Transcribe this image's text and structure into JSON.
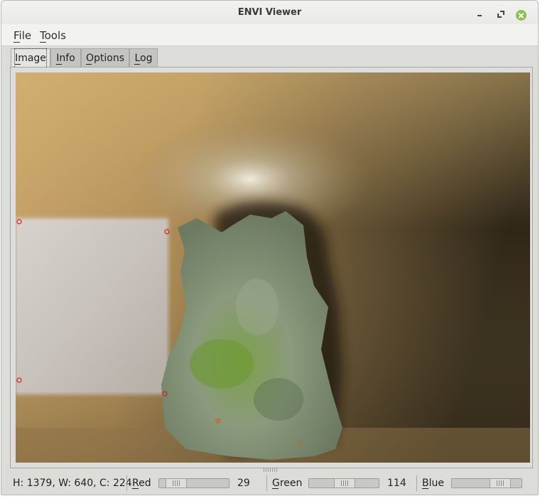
{
  "window": {
    "title": "ENVI Viewer",
    "controls": [
      "minimize-icon",
      "restore-icon",
      "close-icon"
    ],
    "close_color": "#8cc152"
  },
  "menubar": {
    "items": [
      {
        "label": "File"
      },
      {
        "label": "Tools"
      }
    ]
  },
  "tabs": [
    {
      "label": "Image",
      "active": true
    },
    {
      "label": "Info",
      "active": false
    },
    {
      "label": "Options",
      "active": false
    },
    {
      "label": "Log",
      "active": false
    }
  ],
  "image_view": {
    "content": "rgb-composite-image",
    "marker_color": "#d02020"
  },
  "statusbar": {
    "dimensions": "H: 1379, W: 640, C: 224",
    "bands": [
      {
        "label": "Red",
        "value": "29",
        "level": 0.13
      },
      {
        "label": "Green",
        "value": "114",
        "level": 0.51
      },
      {
        "label": "Blue",
        "value": "",
        "level": 0.78
      }
    ]
  }
}
